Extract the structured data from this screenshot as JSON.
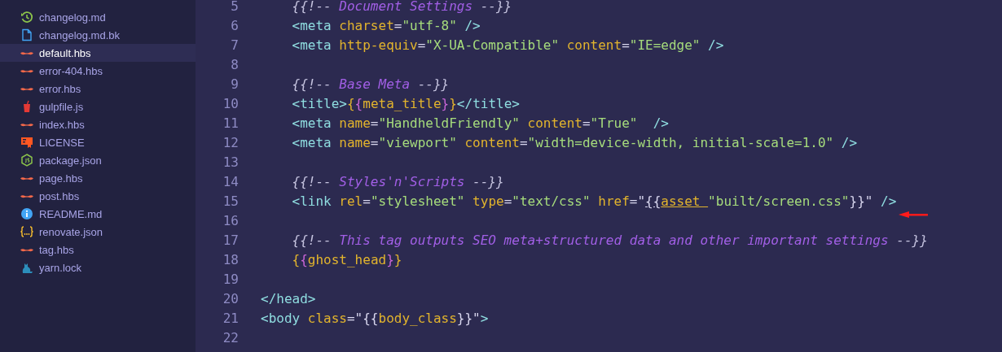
{
  "file_tree": {
    "items": [
      {
        "name": "changelog.md",
        "kind": "history",
        "selected": false
      },
      {
        "name": "changelog.md.bk",
        "kind": "file",
        "selected": false
      },
      {
        "name": "default.hbs",
        "kind": "mustache",
        "selected": true
      },
      {
        "name": "error-404.hbs",
        "kind": "mustache",
        "selected": false
      },
      {
        "name": "error.hbs",
        "kind": "mustache",
        "selected": false
      },
      {
        "name": "gulpfile.js",
        "kind": "cup",
        "selected": false
      },
      {
        "name": "index.hbs",
        "kind": "mustache",
        "selected": false
      },
      {
        "name": "LICENSE",
        "kind": "license",
        "selected": false
      },
      {
        "name": "package.json",
        "kind": "hexagon",
        "selected": false
      },
      {
        "name": "page.hbs",
        "kind": "mustache",
        "selected": false
      },
      {
        "name": "post.hbs",
        "kind": "mustache",
        "selected": false
      },
      {
        "name": "README.md",
        "kind": "info",
        "selected": false
      },
      {
        "name": "renovate.json",
        "kind": "braces",
        "selected": false
      },
      {
        "name": "tag.hbs",
        "kind": "mustache",
        "selected": false
      },
      {
        "name": "yarn.lock",
        "kind": "cat",
        "selected": false
      }
    ]
  },
  "editor": {
    "lines": [
      {
        "number": "5",
        "tokens": [
          {
            "kind": "cp",
            "text": "    {{!-- "
          },
          {
            "kind": "c",
            "text": "Document Settings "
          },
          {
            "kind": "cp",
            "text": "--}}"
          }
        ]
      },
      {
        "number": "6",
        "tokens": [
          {
            "kind": "tag",
            "text": "    <meta "
          },
          {
            "kind": "attr",
            "text": "charset"
          },
          {
            "kind": "p",
            "text": "="
          },
          {
            "kind": "s",
            "text": "\"utf-8\" "
          },
          {
            "kind": "tag",
            "text": "/>"
          }
        ]
      },
      {
        "number": "7",
        "tokens": [
          {
            "kind": "tag",
            "text": "    <meta "
          },
          {
            "kind": "attr",
            "text": "http-equiv"
          },
          {
            "kind": "p",
            "text": "="
          },
          {
            "kind": "s",
            "text": "\"X-UA-Compatible\" "
          },
          {
            "kind": "attr",
            "text": "content"
          },
          {
            "kind": "p",
            "text": "="
          },
          {
            "kind": "s",
            "text": "\"IE=edge\" "
          },
          {
            "kind": "tag",
            "text": "/>"
          }
        ]
      },
      {
        "number": "8"
      },
      {
        "number": "9",
        "tokens": [
          {
            "kind": "cp",
            "text": "    {{!-- "
          },
          {
            "kind": "c",
            "text": "Base Meta "
          },
          {
            "kind": "cp",
            "text": "--}}"
          }
        ]
      },
      {
        "number": "10",
        "tokens": [
          {
            "kind": "tag",
            "text": "    <title>"
          },
          {
            "kind": "hb",
            "text": "{"
          },
          {
            "kind": "hbb",
            "text": "{"
          },
          {
            "kind": "hb",
            "text": "meta_title"
          },
          {
            "kind": "hbb",
            "text": "}"
          },
          {
            "kind": "hb",
            "text": "}"
          },
          {
            "kind": "tag",
            "text": "</title>"
          }
        ]
      },
      {
        "number": "11",
        "tokens": [
          {
            "kind": "tag",
            "text": "    <meta "
          },
          {
            "kind": "attr",
            "text": "name"
          },
          {
            "kind": "p",
            "text": "="
          },
          {
            "kind": "s",
            "text": "\"HandheldFriendly\" "
          },
          {
            "kind": "attr",
            "text": "content"
          },
          {
            "kind": "p",
            "text": "="
          },
          {
            "kind": "s",
            "text": "\"True\"  "
          },
          {
            "kind": "tag",
            "text": "/>"
          }
        ]
      },
      {
        "number": "12",
        "tokens": [
          {
            "kind": "tag",
            "text": "    <meta "
          },
          {
            "kind": "attr",
            "text": "name"
          },
          {
            "kind": "p",
            "text": "="
          },
          {
            "kind": "s",
            "text": "\"viewport\" "
          },
          {
            "kind": "attr",
            "text": "content"
          },
          {
            "kind": "p",
            "text": "="
          },
          {
            "kind": "s",
            "text": "\"width=device-width, initial-scale=1.0\" "
          },
          {
            "kind": "tag",
            "text": "/>"
          }
        ]
      },
      {
        "number": "13"
      },
      {
        "number": "14",
        "tokens": [
          {
            "kind": "cp",
            "text": "    {{!-- "
          },
          {
            "kind": "c",
            "text": "Styles'n'Scripts "
          },
          {
            "kind": "cp",
            "text": "--}}"
          }
        ]
      },
      {
        "number": "15",
        "tokens": [
          {
            "kind": "tag",
            "text": "    <link "
          },
          {
            "kind": "attr",
            "text": "rel"
          },
          {
            "kind": "p",
            "text": "="
          },
          {
            "kind": "s",
            "text": "\"stylesheet\" "
          },
          {
            "kind": "attr",
            "text": "type"
          },
          {
            "kind": "p",
            "text": "="
          },
          {
            "kind": "s",
            "text": "\"text/css\" "
          },
          {
            "kind": "attr",
            "text": "href"
          },
          {
            "kind": "p",
            "text": "=\""
          },
          {
            "kind": "p",
            "text": "{{",
            "underline": true
          },
          {
            "kind": "hb",
            "text": "asset ",
            "underline": true
          },
          {
            "kind": "s",
            "text": "\"built/screen.css\""
          },
          {
            "kind": "p",
            "text": "}}\" "
          },
          {
            "kind": "tag",
            "text": "/>"
          }
        ]
      },
      {
        "number": "16"
      },
      {
        "number": "17",
        "tokens": [
          {
            "kind": "cp",
            "text": "    {{!-- "
          },
          {
            "kind": "c",
            "text": "This tag outputs SEO meta+structured data and other important settings "
          },
          {
            "kind": "cp",
            "text": "--}}"
          }
        ]
      },
      {
        "number": "18",
        "tokens": [
          {
            "kind": "hb",
            "text": "    {"
          },
          {
            "kind": "hbb",
            "text": "{"
          },
          {
            "kind": "hb",
            "text": "ghost_head"
          },
          {
            "kind": "hbb",
            "text": "}"
          },
          {
            "kind": "hb",
            "text": "}"
          }
        ]
      },
      {
        "number": "19"
      },
      {
        "number": "20",
        "tokens": [
          {
            "kind": "tag",
            "text": "</head>"
          }
        ]
      },
      {
        "number": "21",
        "tokens": [
          {
            "kind": "tag",
            "text": "<body "
          },
          {
            "kind": "attr",
            "text": "class"
          },
          {
            "kind": "p",
            "text": "=\"{{"
          },
          {
            "kind": "hb",
            "text": "body_class"
          },
          {
            "kind": "p",
            "text": "}}\""
          },
          {
            "kind": "tag",
            "text": ">"
          }
        ]
      },
      {
        "number": "22"
      }
    ]
  }
}
